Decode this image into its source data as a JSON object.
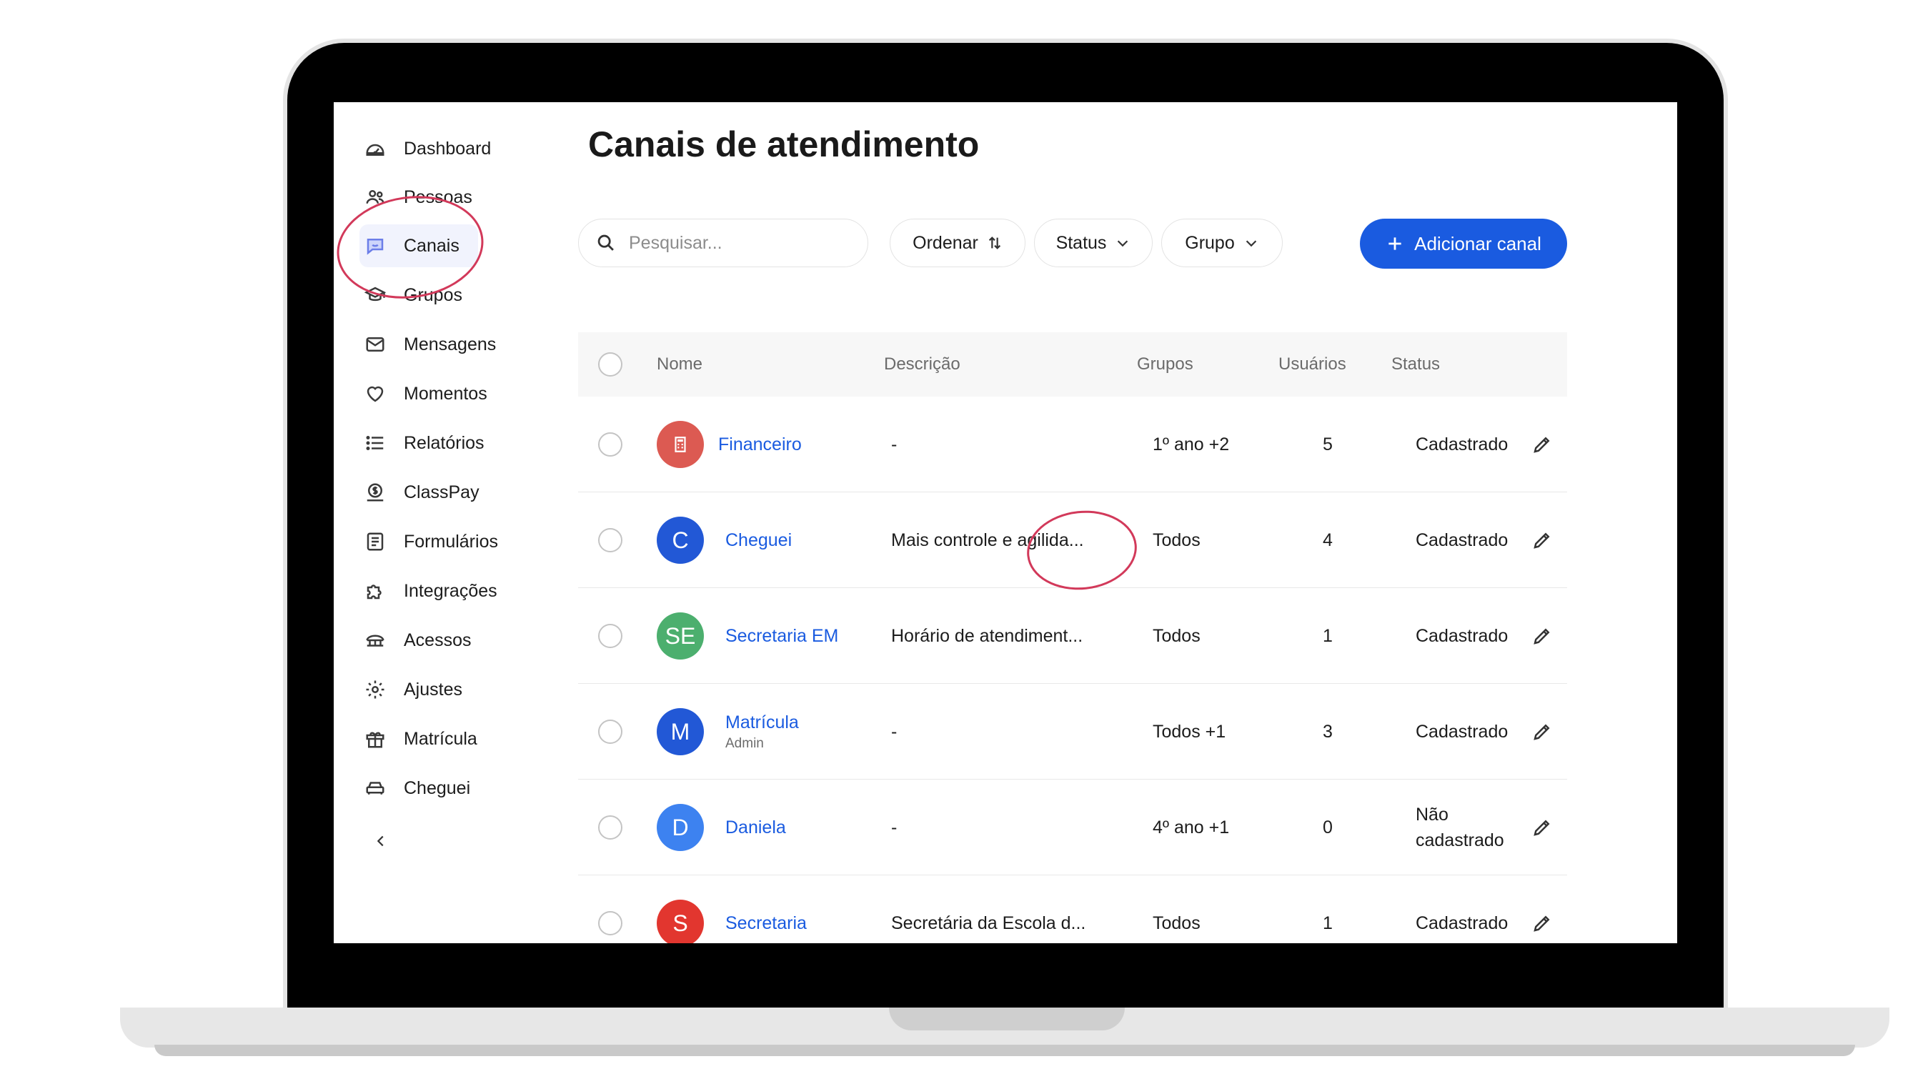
{
  "sidebar": {
    "items": [
      {
        "label": "Dashboard",
        "icon": "dashboard-icon"
      },
      {
        "label": "Pessoas",
        "icon": "people-icon"
      },
      {
        "label": "Canais",
        "icon": "chat-icon",
        "active": true
      },
      {
        "label": "Grupos",
        "icon": "graduation-cap-icon"
      },
      {
        "label": "Mensagens",
        "icon": "mail-icon"
      },
      {
        "label": "Momentos",
        "icon": "heart-icon"
      },
      {
        "label": "Relatórios",
        "icon": "list-icon"
      },
      {
        "label": "ClassPay",
        "icon": "coin-icon"
      },
      {
        "label": "Formulários",
        "icon": "form-icon"
      },
      {
        "label": "Integrações",
        "icon": "puzzle-icon"
      },
      {
        "label": "Acessos",
        "icon": "gate-icon"
      },
      {
        "label": "Ajustes",
        "icon": "gear-icon"
      },
      {
        "label": "Matrícula",
        "icon": "gift-icon"
      },
      {
        "label": "Cheguei",
        "icon": "car-icon"
      }
    ]
  },
  "main": {
    "title": "Canais de atendimento",
    "search": {
      "placeholder": "Pesquisar..."
    },
    "filters": {
      "sort_label": "Ordenar",
      "status_label": "Status",
      "group_label": "Grupo"
    },
    "add_button": "Adicionar canal"
  },
  "table": {
    "headers": {
      "name": "Nome",
      "description": "Descrição",
      "groups": "Grupos",
      "users": "Usuários",
      "status": "Status"
    },
    "rows": [
      {
        "avatar": "",
        "avatar_icon": "calculator-icon",
        "avatar_color": "#dc5a52",
        "name": "Financeiro",
        "sub": "",
        "description": "-",
        "groups": "1º ano +2",
        "users": "5",
        "status": "Cadastrado"
      },
      {
        "avatar": "C",
        "avatar_color": "#2258d6",
        "name": "Cheguei",
        "sub": "",
        "description": "Mais controle e agilida...",
        "groups": "Todos",
        "users": "4",
        "status": "Cadastrado"
      },
      {
        "avatar": "SE",
        "avatar_color": "#4caf6e",
        "name": "Secretaria EM",
        "sub": "",
        "description": "Horário de atendiment...",
        "groups": "Todos",
        "users": "1",
        "status": "Cadastrado"
      },
      {
        "avatar": "M",
        "avatar_color": "#2258d6",
        "name": "Matrícula",
        "sub": "Admin",
        "description": "-",
        "groups": "Todos +1",
        "users": "3",
        "status": "Cadastrado"
      },
      {
        "avatar": "D",
        "avatar_color": "#3d82f0",
        "name": "Daniela",
        "sub": "",
        "description": "-",
        "groups": "4º ano +1",
        "users": "0",
        "status": "Não cadastrado"
      },
      {
        "avatar": "S",
        "avatar_color": "#e2362f",
        "name": "Secretaria",
        "sub": "",
        "description": "Secretária da Escola d...",
        "groups": "Todos",
        "users": "1",
        "status": "Cadastrado"
      }
    ]
  },
  "colors": {
    "accent": "#1a5be0",
    "annotation": "#d2395a",
    "active_nav_bg": "#f1f3fd"
  }
}
